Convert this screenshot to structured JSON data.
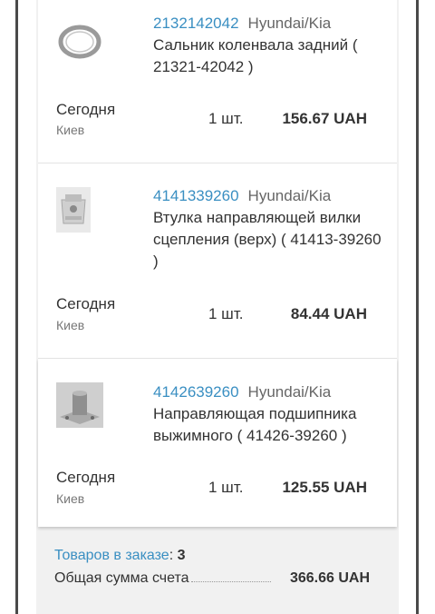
{
  "items": [
    {
      "code": "2132142042",
      "brand": "Hyundai/Kia",
      "name": "Сальник коленвала задний ( 21321-42042 )",
      "delivery": "Сегодня",
      "city": "Киев",
      "qty": "1 шт.",
      "price": "156.67 UAH",
      "thumb_icon": "oil-seal-ring-icon"
    },
    {
      "code": "4141339260",
      "brand": "Hyundai/Kia",
      "name": "Втулка направляющей вилки сцепления (верх) ( 41413-39260 )",
      "delivery": "Сегодня",
      "city": "Киев",
      "qty": "1 шт.",
      "price": "84.44 UAH",
      "thumb_icon": "bushing-photo-icon"
    },
    {
      "code": "4142639260",
      "brand": "Hyundai/Kia",
      "name": "Направляющая подшипника выжимного ( 41426-39260 )",
      "delivery": "Сегодня",
      "city": "Киев",
      "qty": "1 шт.",
      "price": "125.55 UAH",
      "thumb_icon": "bearing-guide-photo-icon"
    }
  ],
  "summary": {
    "items_label": "Товаров в заказе",
    "items_count": "3",
    "total_label": "Общая сумма счета",
    "total_value": "366.66 UAH"
  }
}
